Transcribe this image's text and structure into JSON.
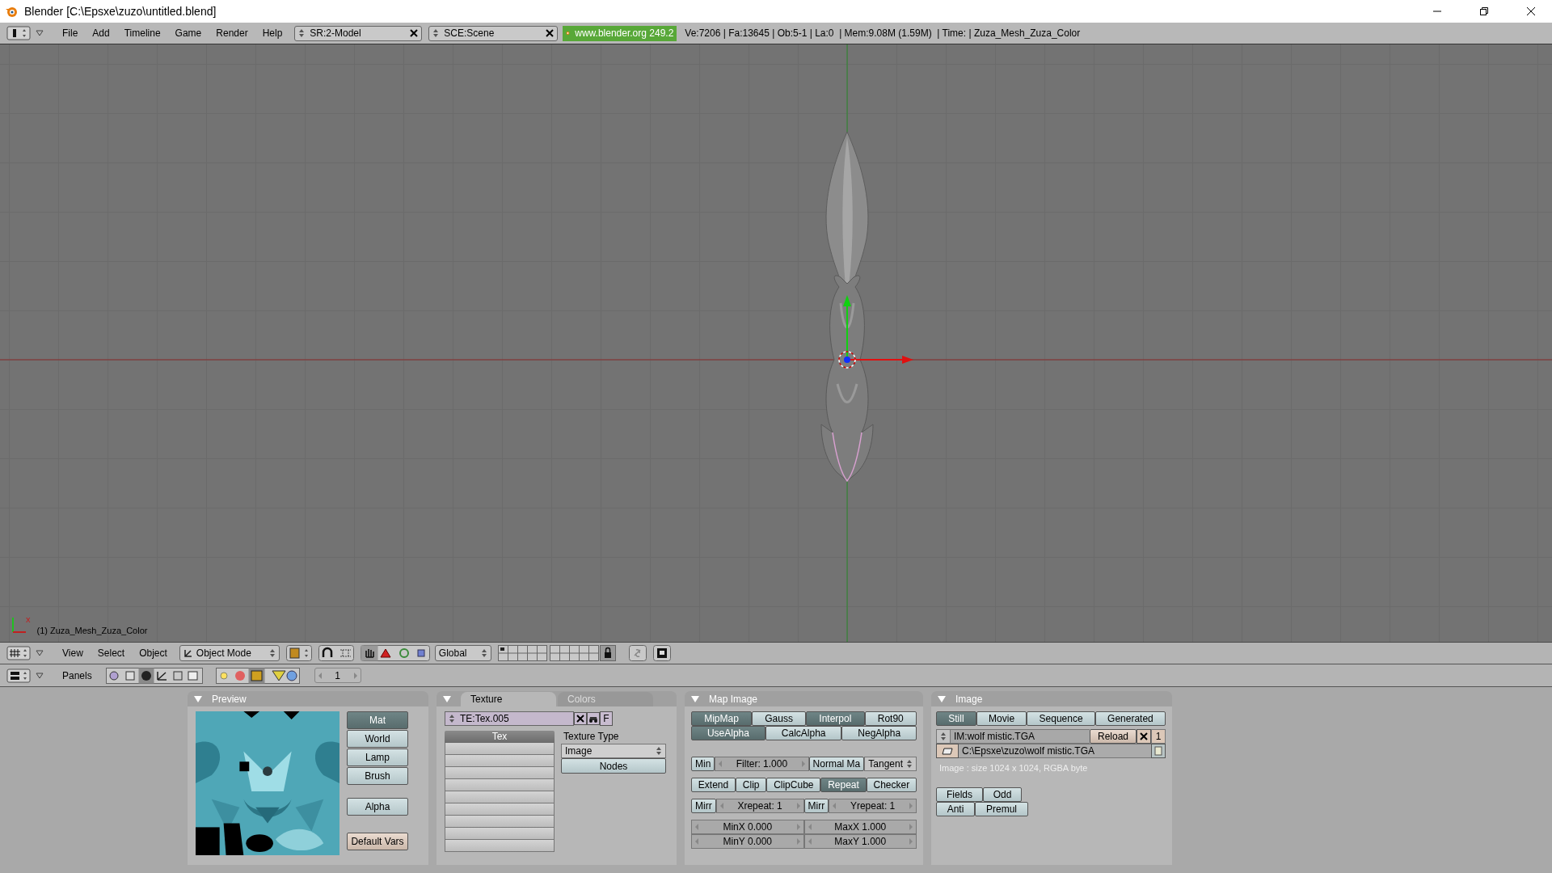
{
  "window": {
    "title": "Blender [C:\\Epsxe\\zuzo\\untitled.blend]"
  },
  "info_header": {
    "menus": [
      "File",
      "Add",
      "Timeline",
      "Game",
      "Render",
      "Help"
    ],
    "screen": "SR:2-Model",
    "scene": "SCE:Scene",
    "website": "www.blender.org 249.2",
    "stats": "Ve:7206 | Fa:13645 | Ob:5-1 | La:0  | Mem:9.08M (1.59M)  | Time: | Zuza_Mesh_Zuza_Color"
  },
  "viewport": {
    "axis_label": "x",
    "object_label": "(1) Zuza_Mesh_Zuza_Color"
  },
  "view_header": {
    "menus": [
      "View",
      "Select",
      "Object"
    ],
    "mode": "Object Mode",
    "orientation": "Global"
  },
  "buttons_header": {
    "label": "Panels",
    "frame": "1"
  },
  "preview": {
    "title": "Preview",
    "sources": [
      {
        "label": "Mat",
        "selected": true
      },
      {
        "label": "World",
        "selected": false
      },
      {
        "label": "Lamp",
        "selected": false
      },
      {
        "label": "Brush",
        "selected": false
      }
    ],
    "alpha": {
      "label": "Alpha",
      "selected": false
    },
    "default_vars": "Default Vars"
  },
  "texture": {
    "tabs": [
      {
        "label": "Texture",
        "selected": true
      },
      {
        "label": "Colors",
        "selected": false
      }
    ],
    "name": "TE:Tex.005",
    "fake_user": "F",
    "list_header": "Tex",
    "type_label": "Texture Type",
    "type_value": "Image",
    "nodes": "Nodes"
  },
  "map_image": {
    "title": "Map Image",
    "groups": [
      [
        [
          {
            "kind": "toggle",
            "label": "MipMap",
            "selected": true
          },
          {
            "kind": "toggle",
            "label": "Gauss",
            "selected": false
          },
          {
            "kind": "toggle",
            "label": "Interpol",
            "selected": true
          },
          {
            "kind": "toggle",
            "label": "Rot90",
            "selected": false
          }
        ],
        [
          {
            "kind": "toggle",
            "label": "UseAlpha",
            "selected": true
          },
          {
            "kind": "toggle",
            "label": "CalcAlpha",
            "selected": false
          },
          {
            "kind": "toggle",
            "label": "NegAlpha",
            "selected": false
          }
        ]
      ],
      [
        [
          {
            "kind": "toggle",
            "label": "Min",
            "selected": false
          },
          {
            "kind": "number",
            "label": "Filter: 1.000"
          },
          {
            "kind": "toggle",
            "label": "Normal Ma",
            "selected": false
          },
          {
            "kind": "menu",
            "label": "Tangent"
          }
        ]
      ],
      [
        [
          {
            "kind": "toggle",
            "label": "Extend",
            "selected": false
          },
          {
            "kind": "toggle",
            "label": "Clip",
            "selected": false
          },
          {
            "kind": "toggle",
            "label": "ClipCube",
            "selected": false
          },
          {
            "kind": "toggle",
            "label": "Repeat",
            "selected": true
          },
          {
            "kind": "toggle",
            "label": "Checker",
            "selected": false
          }
        ]
      ],
      [
        [
          {
            "kind": "toggle",
            "label": "Mirr",
            "selected": false
          },
          {
            "kind": "number",
            "label": "Xrepeat: 1"
          },
          {
            "kind": "toggle",
            "label": "Mirr",
            "selected": false
          },
          {
            "kind": "number",
            "label": "Yrepeat: 1"
          }
        ]
      ],
      [
        [
          {
            "kind": "number",
            "label": "MinX 0.000"
          },
          {
            "kind": "number",
            "label": "MaxX 1.000"
          }
        ],
        [
          {
            "kind": "number",
            "label": "MinY 0.000"
          },
          {
            "kind": "number",
            "label": "MaxY 1.000"
          }
        ]
      ]
    ]
  },
  "image": {
    "title": "Image",
    "sources": [
      {
        "label": "Still",
        "selected": true
      },
      {
        "label": "Movie",
        "selected": false
      },
      {
        "label": "Sequence",
        "selected": false
      },
      {
        "label": "Generated",
        "selected": false
      }
    ],
    "name": "IM:wolf mistic.TGA",
    "reload": "Reload",
    "users": "1",
    "path": "C:\\Epsxe\\zuzo\\wolf mistic.TGA",
    "info": "Image : size 1024 x 1024, RGBA byte",
    "options": [
      [
        {
          "label": "Fields",
          "selected": false
        },
        {
          "label": "Odd",
          "selected": false
        }
      ],
      [
        {
          "label": "Anti",
          "selected": false
        },
        {
          "label": "Premul",
          "selected": false
        }
      ]
    ]
  }
}
